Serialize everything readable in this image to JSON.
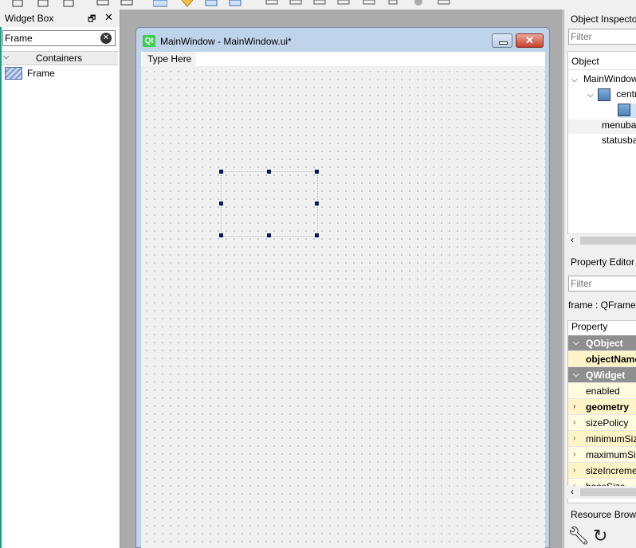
{
  "widget_box": {
    "title": "Widget Box",
    "float_icon": "float-icon",
    "close_icon": "close-icon",
    "filter_value": "Frame",
    "category": "Containers",
    "items": [
      {
        "label": "Frame",
        "icon": "frame-icon"
      }
    ]
  },
  "main_window": {
    "title": "MainWindow - MainWindow.ui*",
    "logo_text": "Qt",
    "menubar_placeholder": "Type Here"
  },
  "object_inspector": {
    "title": "Object Inspector",
    "filter_placeholder": "Filter",
    "header": "Object",
    "rows": [
      "MainWindow",
      "centralwidget",
      "menubar",
      "statusbar"
    ]
  },
  "property_editor": {
    "title": "Property Editor",
    "filter_placeholder": "Filter",
    "object_label": "frame : QFrame",
    "header": "Property",
    "rows": [
      {
        "label": "QObject",
        "group": true
      },
      {
        "label": "objectName",
        "bold": true
      },
      {
        "label": "QWidget",
        "group": true
      },
      {
        "label": "enabled"
      },
      {
        "label": "geometry",
        "bold": true
      },
      {
        "label": "sizePolicy"
      },
      {
        "label": "minimumSize"
      },
      {
        "label": "maximumSize"
      },
      {
        "label": "sizeIncrement"
      },
      {
        "label": "baseSize"
      }
    ]
  },
  "resource_browser": {
    "title": "Resource Browser",
    "icons": [
      "wrench-icon",
      "reload-icon"
    ]
  },
  "colors": {
    "accent_teal": "#1c9c8c",
    "qt_green": "#41cd52",
    "handle_navy": "#001a66",
    "group_gray": "#8f8f8f"
  }
}
